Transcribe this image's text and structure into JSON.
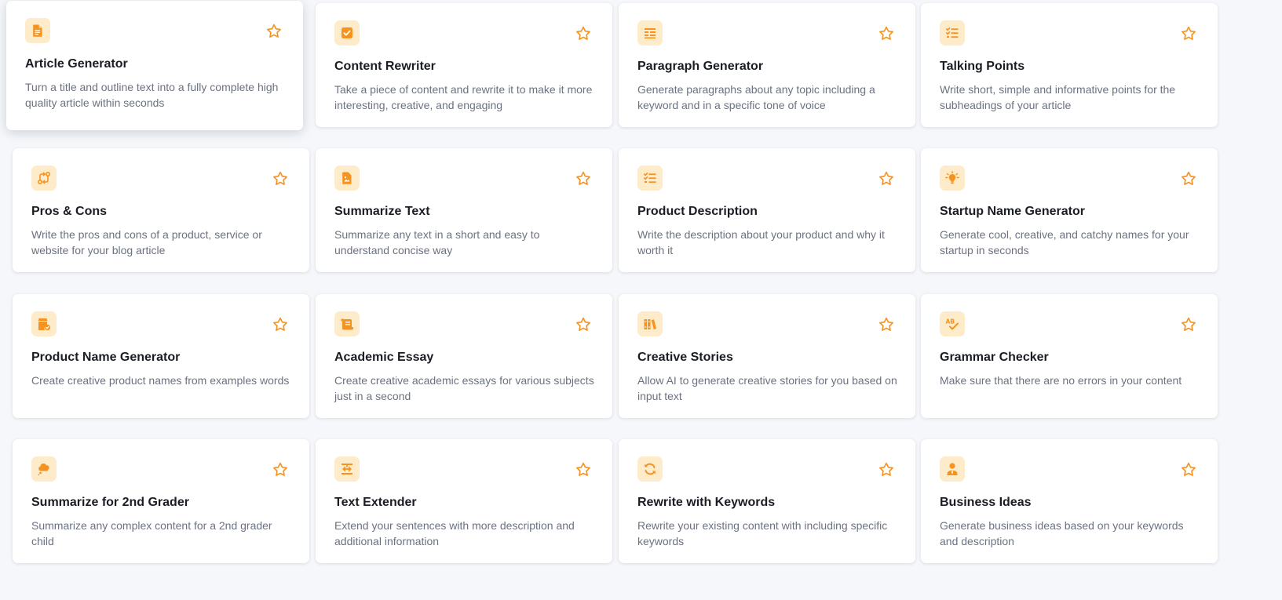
{
  "colors": {
    "accent": "#f5931e",
    "icon_bg": "#fdebc9",
    "title": "#1a1d24",
    "description": "#6b7280",
    "background": "#f5f7fa"
  },
  "templates": [
    {
      "title": "Article Generator",
      "description": "Turn a title and outline text into a fully complete high quality article within seconds",
      "icon": "document-icon"
    },
    {
      "title": "Content Rewriter",
      "description": "Take a piece of content and rewrite it to make it more interesting, creative, and engaging",
      "icon": "checkbox-icon"
    },
    {
      "title": "Paragraph Generator",
      "description": "Generate paragraphs about any topic including a keyword and in a specific tone of voice",
      "icon": "paragraph-icon"
    },
    {
      "title": "Talking Points",
      "description": "Write short, simple and informative points for the subheadings of your article",
      "icon": "checklist-icon"
    },
    {
      "title": "Pros & Cons",
      "description": "Write the pros and cons of a product, service or website for your blog article",
      "icon": "swap-icon"
    },
    {
      "title": "Summarize Text",
      "description": "Summarize any text in a short and easy to understand concise way",
      "icon": "file-image-icon"
    },
    {
      "title": "Product Description",
      "description": "Write the description about your product and why it worth it",
      "icon": "checklist-icon"
    },
    {
      "title": "Startup Name Generator",
      "description": "Generate cool, creative, and catchy names for your startup in seconds",
      "icon": "lightbulb-icon"
    },
    {
      "title": "Product Name Generator",
      "description": "Create creative product names from examples words",
      "icon": "box-check-icon"
    },
    {
      "title": "Academic Essay",
      "description": "Create creative academic essays for various subjects just in a second",
      "icon": "scroll-icon"
    },
    {
      "title": "Creative Stories",
      "description": "Allow AI to generate creative stories for you based on input text",
      "icon": "books-icon"
    },
    {
      "title": "Grammar Checker",
      "description": "Make sure that there are no errors in your content",
      "icon": "spellcheck-icon"
    },
    {
      "title": "Summarize for 2nd Grader",
      "description": "Summarize any complex content for a 2nd grader child",
      "icon": "thought-cloud-icon"
    },
    {
      "title": "Text Extender",
      "description": "Extend your sentences with more description and additional information",
      "icon": "text-extend-icon"
    },
    {
      "title": "Rewrite with Keywords",
      "description": "Rewrite your existing content with including specific keywords",
      "icon": "refresh-icon"
    },
    {
      "title": "Business Ideas",
      "description": "Generate business ideas based on your keywords and description",
      "icon": "user-tie-icon"
    }
  ]
}
